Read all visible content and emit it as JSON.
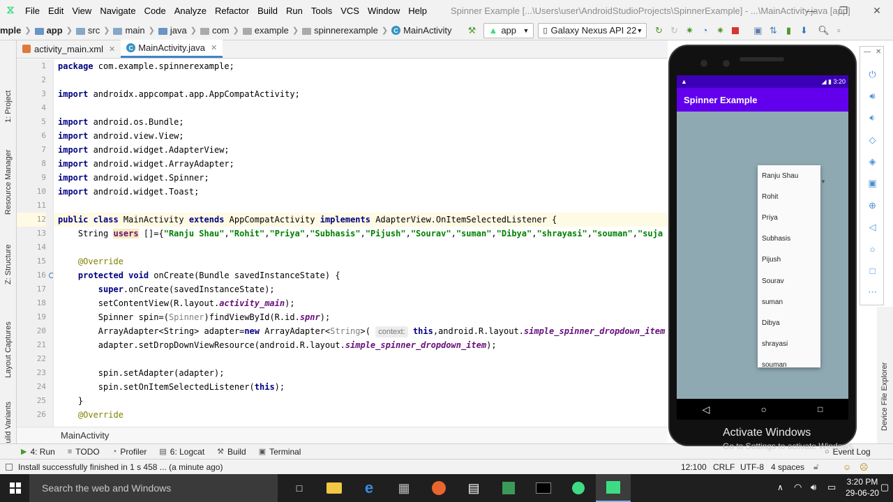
{
  "menubar": {
    "items": [
      "File",
      "Edit",
      "View",
      "Navigate",
      "Code",
      "Analyze",
      "Refactor",
      "Build",
      "Run",
      "Tools",
      "VCS",
      "Window",
      "Help"
    ],
    "title": "Spinner Example [...\\Users\\user\\AndroidStudioProjects\\SpinnerExample] - ...\\MainActivity.java [app]"
  },
  "toolbar": {
    "breadcrumb": [
      "mple",
      "app",
      "src",
      "main",
      "java",
      "com",
      "example",
      "spinnerexample",
      "MainActivity"
    ],
    "run_config": "app",
    "device": "Galaxy Nexus API 22"
  },
  "left_tools": [
    "1: Project",
    "Resource Manager",
    "Z: Structure",
    "Layout Captures",
    "Build Variants"
  ],
  "tabs": [
    {
      "label": "activity_main.xml"
    },
    {
      "label": "MainActivity.java"
    }
  ],
  "editor": {
    "line_numbers": [
      "1",
      "2",
      "3",
      "4",
      "5",
      "6",
      "7",
      "8",
      "9",
      "10",
      "11",
      "12",
      "13",
      "14",
      "15",
      "16",
      "17",
      "18",
      "19",
      "20",
      "21",
      "22",
      "23",
      "24",
      "25",
      "26"
    ],
    "l1a": "package",
    "l1b": " com.example.spinnerexample;",
    "imp": "import",
    "l3": " androidx.appcompat.app.AppCompatActivity;",
    "l5": " android.os.Bundle;",
    "l6": " android.view.View;",
    "l7": " android.widget.AdapterView;",
    "l8": " android.widget.ArrayAdapter;",
    "l9": " android.widget.Spinner;",
    "l10": " android.widget.Toast;",
    "l12a": "public class",
    "l12b": " MainActivity ",
    "l12c": "extends",
    "l12d": " AppCompatActivity ",
    "l12e": "implements",
    "l12f": " AdapterView.OnItemSelectedListener {",
    "l13a": "    String ",
    "l13b": "users",
    "l13c": " []={",
    "users": [
      "\"Ranju Shau\"",
      "\"Rohit\"",
      "\"Priya\"",
      "\"Subhasis\"",
      "\"Pijush\"",
      "\"Sourav\"",
      "\"suman\"",
      "\"Dibya\"",
      "\"shrayasi\"",
      "\"souman\"",
      "\"suja"
    ],
    "l15": "    @Override",
    "l16a": "    protected void",
    "l16b": " onCreate(Bundle savedInstanceState) {",
    "l17a": "        super",
    "l17b": ".onCreate(savedInstanceState);",
    "l18a": "        setContentView(R.layout.",
    "l18b": "activity_main",
    "l18c": ");",
    "l19a": "        Spinner spin=(",
    "l19b": "Spinner",
    "l19c": ")findViewById(R.id.",
    "l19d": "spnr",
    "l19e": ");",
    "l20a": "        ArrayAdapter<String> adapter=",
    "l20b": "new",
    "l20c": " ArrayAdapter<",
    "l20d": "String",
    "l20e": ">( ",
    "l20hint": "context:",
    "l20f": " this",
    "l20g": ",android.R.layout.",
    "l20h": "simple_spinner_dropdown_item",
    "l21a": "        adapter.setDropDownViewResource(android.R.layout.",
    "l21b": "simple_spinner_dropdown_item",
    "l21c": ");",
    "l23": "        spin.setAdapter(adapter);",
    "l24a": "        spin.setOnItemSelectedListener(",
    "l24b": "this",
    "l24c": ");",
    "l25": "    }",
    "l26": "    @Override"
  },
  "editor_breadcrumb": "MainActivity",
  "tool_windows": [
    {
      "key": "4",
      "label": "4: Run"
    },
    {
      "label": "TODO"
    },
    {
      "label": "Profiler"
    },
    {
      "label": "6: Logcat"
    },
    {
      "label": "Build"
    },
    {
      "label": "Terminal"
    }
  ],
  "event_log": "Event Log",
  "status": {
    "message": "Install successfully finished in 1 s 458 ... (a minute ago)",
    "position": "12:100",
    "line_sep": "CRLF",
    "encoding": "UTF-8",
    "indent": "4 spaces"
  },
  "emulator": {
    "time": "3:20",
    "app_title": "Spinner Example",
    "dropdown_items": [
      "Ranju Shau",
      "Rohit",
      "Priya",
      "Subhasis",
      "Pijush",
      "Sourav",
      "suman",
      "Dibya",
      "shrayasi",
      "souman"
    ]
  },
  "right_tool": "Device File Explorer",
  "watermark": {
    "line1": "Activate Windows",
    "line2": "Go to Settings to activate Windows."
  },
  "taskbar": {
    "search_placeholder": "Search the web and Windows",
    "time": "3:20 PM",
    "date": "29-06-20"
  }
}
